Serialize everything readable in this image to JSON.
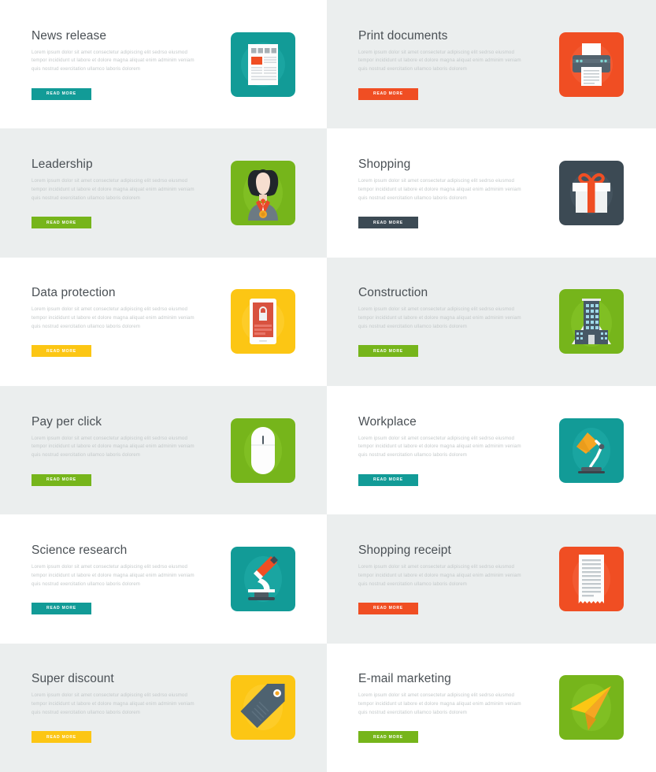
{
  "page": {
    "layout": "two-column-feature-grid",
    "columns": 2,
    "rows": 6,
    "background_white": "#ffffff",
    "background_gray": "#ebeeee",
    "title_color": "#4a5055",
    "description_color": "#c3c8c9",
    "description_text": "Lorem ipsum dolor sit amet consectetur adipiscing elit sedrso eiusmod tempor incididunt ut labore et dolore magna aliquat enim adminim veniam quis nostrud exercitation ullamco laboris dolorem",
    "button_label": "READ MORE"
  },
  "cards": [
    {
      "title": "News release",
      "description": "Lorem ipsum dolor sit amet consectetur adipiscing elit sedrso eiusmod tempor incididunt ut labore et dolore magna aliquat enim adminim veniam quis nostrud exercitation ullamco laboris dolorem",
      "button_label": "READ MORE",
      "accent": "#129b97",
      "panel_background": "#ffffff",
      "icon": "newspaper-icon",
      "column": "left",
      "row": 1
    },
    {
      "title": "Print documents",
      "description": "Lorem ipsum dolor sit amet consectetur adipiscing elit sedrso eiusmod tempor incididunt ut labore et dolore magna aliquat enim adminim veniam quis nostrud exercitation ullamco laboris dolorem",
      "button_label": "READ MORE",
      "accent": "#f04e23",
      "panel_background": "#ebeeee",
      "icon": "printer-icon",
      "column": "right",
      "row": 1
    },
    {
      "title": "Leadership",
      "description": "Lorem ipsum dolor sit amet consectetur adipiscing elit sedrso eiusmod tempor incididunt ut labore et dolore magna aliquat enim adminim veniam quis nostrud exercitation ullamco laboris dolorem",
      "button_label": "READ MORE",
      "accent": "#76b51b",
      "panel_background": "#ebeeee",
      "icon": "businessman-medal-icon",
      "column": "left",
      "row": 2
    },
    {
      "title": "Shopping",
      "description": "Lorem ipsum dolor sit amet consectetur adipiscing elit sedrso eiusmod tempor incididunt ut labore et dolore magna aliquat enim adminim veniam quis nostrud exercitation ullamco laboris dolorem",
      "button_label": "READ MORE",
      "accent": "#3c4a54",
      "panel_background": "#ffffff",
      "icon": "gift-box-icon",
      "column": "right",
      "row": 2
    },
    {
      "title": "Data protection",
      "description": "Lorem ipsum dolor sit amet consectetur adipiscing elit sedrso eiusmod tempor incididunt ut labore et dolore magna aliquat enim adminim veniam quis nostrud exercitation ullamco laboris dolorem",
      "button_label": "READ MORE",
      "accent": "#fcc614",
      "panel_background": "#ffffff",
      "icon": "tablet-lock-icon",
      "column": "left",
      "row": 3
    },
    {
      "title": "Construction",
      "description": "Lorem ipsum dolor sit amet consectetur adipiscing elit sedrso eiusmod tempor incididunt ut labore et dolore magna aliquat enim adminim veniam quis nostrud exercitation ullamco laboris dolorem",
      "button_label": "READ MORE",
      "accent": "#76b51b",
      "panel_background": "#ebeeee",
      "icon": "office-building-icon",
      "column": "right",
      "row": 3
    },
    {
      "title": "Pay per click",
      "description": "Lorem ipsum dolor sit amet consectetur adipiscing elit sedrso eiusmod tempor incididunt ut labore et dolore magna aliquat enim adminim veniam quis nostrud exercitation ullamco laboris dolorem",
      "button_label": "READ MORE",
      "accent": "#76b51b",
      "panel_background": "#ebeeee",
      "icon": "computer-mouse-icon",
      "column": "left",
      "row": 4
    },
    {
      "title": "Workplace",
      "description": "Lorem ipsum dolor sit amet consectetur adipiscing elit sedrso eiusmod tempor incididunt ut labore et dolore magna aliquat enim adminim veniam quis nostrud exercitation ullamco laboris dolorem",
      "button_label": "READ MORE",
      "accent": "#129b97",
      "panel_background": "#ffffff",
      "icon": "desk-lamp-icon",
      "column": "right",
      "row": 4
    },
    {
      "title": "Science research",
      "description": "Lorem ipsum dolor sit amet consectetur adipiscing elit sedrso eiusmod tempor incididunt ut labore et dolore magna aliquat enim adminim veniam quis nostrud exercitation ullamco laboris dolorem",
      "button_label": "READ MORE",
      "accent": "#129b97",
      "panel_background": "#ffffff",
      "icon": "microscope-icon",
      "column": "left",
      "row": 5
    },
    {
      "title": "Shopping receipt",
      "description": "Lorem ipsum dolor sit amet consectetur adipiscing elit sedrso eiusmod tempor incididunt ut labore et dolore magna aliquat enim adminim veniam quis nostrud exercitation ullamco laboris dolorem",
      "button_label": "READ MORE",
      "accent": "#f04e23",
      "panel_background": "#ebeeee",
      "icon": "receipt-icon",
      "column": "right",
      "row": 5
    },
    {
      "title": "Super discount",
      "description": "Lorem ipsum dolor sit amet consectetur adipiscing elit sedrso eiusmod tempor incididunt ut labore et dolore magna aliquat enim adminim veniam quis nostrud exercitation ullamco laboris dolorem",
      "button_label": "READ MORE",
      "accent": "#fcc614",
      "panel_background": "#ebeeee",
      "icon": "price-tag-icon",
      "column": "left",
      "row": 6
    },
    {
      "title": "E-mail marketing",
      "description": "Lorem ipsum dolor sit amet consectetur adipiscing elit sedrso eiusmod tempor incididunt ut labore et dolore magna aliquat enim adminim veniam quis nostrud exercitation ullamco laboris dolorem",
      "button_label": "READ MORE",
      "accent": "#76b51b",
      "panel_background": "#ffffff",
      "icon": "paper-plane-icon",
      "column": "right",
      "row": 6
    }
  ]
}
